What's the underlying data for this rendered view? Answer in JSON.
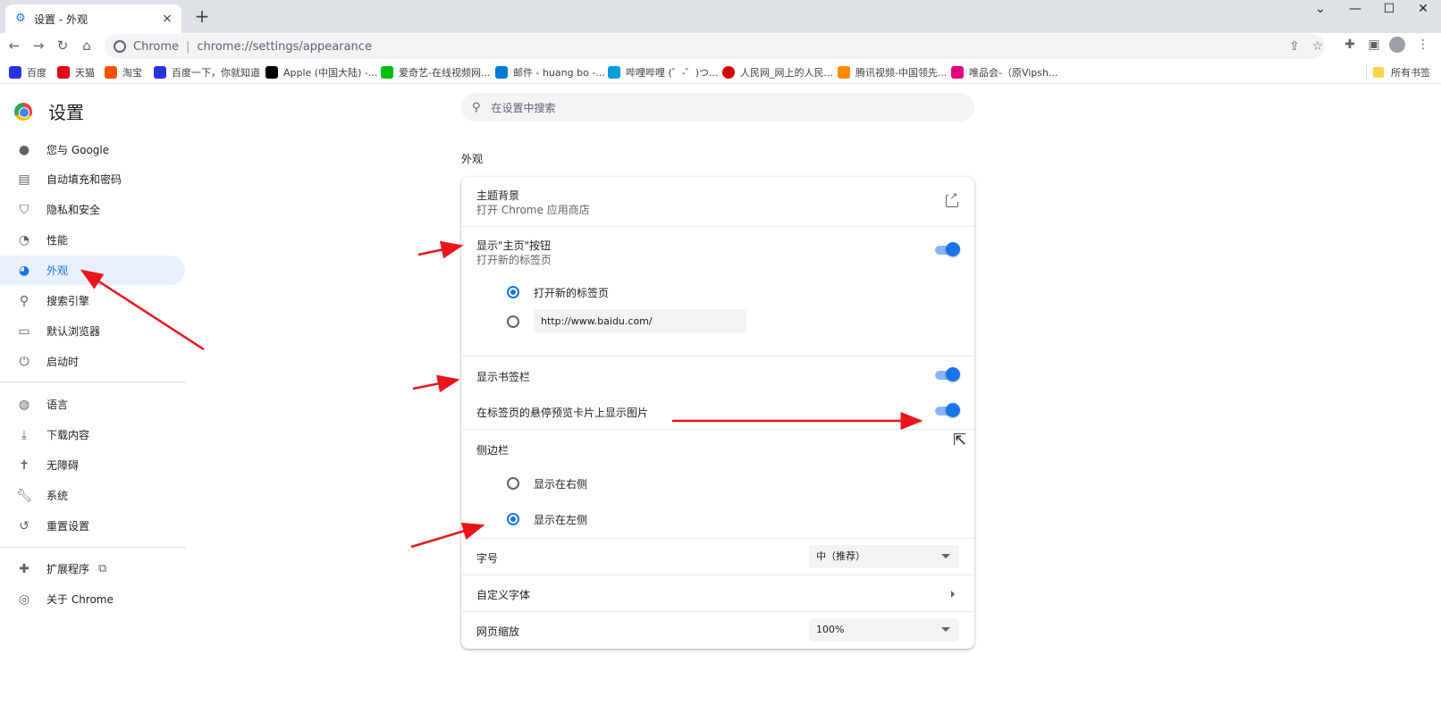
{
  "tab": {
    "favicon_icon": "gear-icon",
    "title": "设置 - 外观",
    "close": "×"
  },
  "new_tab": "+",
  "window_controls": {
    "chevron": "⌄",
    "minimize": "—",
    "maximize": "☐",
    "close": "✕"
  },
  "toolbar": {
    "back": "←",
    "forward": "→",
    "reload": "↻",
    "home": "⌂",
    "omnibox_label": "Chrome",
    "separator": "|",
    "url": "chrome://settings/appearance"
  },
  "bookmarks": [
    {
      "label": "百度",
      "icon": "baidu-icon",
      "color": "#2932e1"
    },
    {
      "label": "天猫",
      "icon": "tmall-icon",
      "color": "#e0001b"
    },
    {
      "label": "淘宝",
      "icon": "taobao-icon",
      "color": "#ff5000"
    },
    {
      "label": "百度一下，你就知道",
      "icon": "baidu-icon",
      "color": "#2932e1"
    },
    {
      "label": "Apple (中国大陆) -...",
      "icon": "apple-icon",
      "color": "#000000"
    },
    {
      "label": "爱奇艺-在线视频网...",
      "icon": "iqiyi-icon",
      "color": "#00be06"
    },
    {
      "label": "邮件 - huang bo -...",
      "icon": "outlook-icon",
      "color": "#0078d4"
    },
    {
      "label": "哔哩哔哩 (゜-゜)つ...",
      "icon": "bilibili-icon",
      "color": "#00a1d6"
    },
    {
      "label": "人民网_网上的人民...",
      "icon": "people-daily-icon",
      "color": "#d50000"
    },
    {
      "label": "腾讯视频-中国领先...",
      "icon": "tencent-video-icon",
      "color": "#ff8a00"
    },
    {
      "label": "唯品会-（原Vipsh...",
      "icon": "vip-icon",
      "color": "#e4007f"
    }
  ],
  "bookmarks_all": "所有书签",
  "settings": {
    "title": "设置",
    "search_placeholder": "在设置中搜索",
    "nav": [
      {
        "label": "您与 Google",
        "icon": "person-icon"
      },
      {
        "label": "自动填充和密码",
        "icon": "clipboard-icon"
      },
      {
        "label": "隐私和安全",
        "icon": "shield-icon"
      },
      {
        "label": "性能",
        "icon": "speedometer-icon"
      },
      {
        "label": "外观",
        "icon": "palette-icon",
        "active": true
      },
      {
        "label": "搜索引擎",
        "icon": "search-icon"
      },
      {
        "label": "默认浏览器",
        "icon": "browser-icon"
      },
      {
        "label": "启动时",
        "icon": "power-icon"
      },
      {
        "label": "语言",
        "icon": "globe-icon"
      },
      {
        "label": "下载内容",
        "icon": "download-icon"
      },
      {
        "label": "无障碍",
        "icon": "accessibility-icon"
      },
      {
        "label": "系统",
        "icon": "wrench-icon"
      },
      {
        "label": "重置设置",
        "icon": "restore-icon"
      },
      {
        "label": "扩展程序",
        "icon": "puzzle-icon"
      },
      {
        "label": "关于 Chrome",
        "icon": "chrome-icon"
      }
    ],
    "section_title": "外观",
    "theme": {
      "label": "主题背景",
      "sub": "打开 Chrome 应用商店"
    },
    "home_button": {
      "label": "显示\"主页\"按钮",
      "sub": "打开新的标签页",
      "enabled": true,
      "option_new_tab": "打开新的标签页",
      "option_url": "http://www.baidu.com/",
      "selected": "new_tab"
    },
    "bookmarks_bar": {
      "label": "显示书签栏",
      "enabled": true
    },
    "tab_hover_preview": {
      "label": "在标签页的悬停预览卡片上显示图片",
      "enabled": true
    },
    "side_panel": {
      "label": "侧边栏",
      "option_right": "显示在右侧",
      "option_left": "显示在左侧",
      "selected": "left"
    },
    "font_size": {
      "label": "字号",
      "value": "中（推荐）"
    },
    "custom_fonts": {
      "label": "自定义字体"
    },
    "page_zoom": {
      "label": "网页缩放",
      "value": "100%"
    }
  },
  "colors": {
    "accent": "#1a73e8",
    "annotation_arrow": "#e8151b"
  }
}
